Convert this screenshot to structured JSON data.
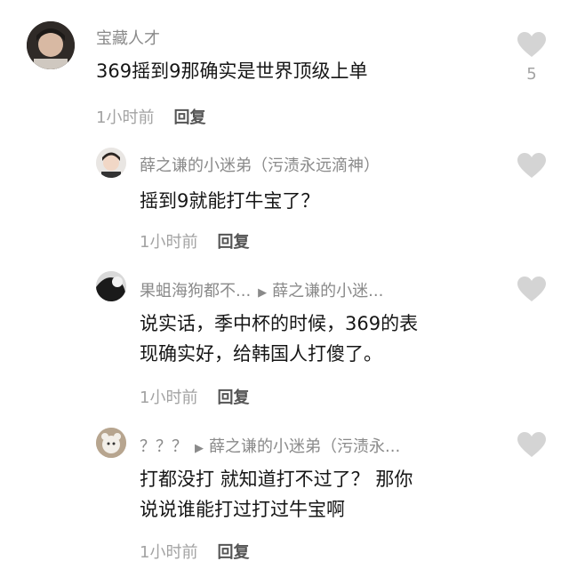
{
  "comments": [
    {
      "user": "宝藏人才",
      "text": "369摇到9那确实是世界顶级上单",
      "time": "1小时前",
      "reply_label": "回复",
      "likes": "5",
      "like_icon": "heart-icon"
    },
    {
      "user": "薛之谦的小迷弟（污渍永远滴神）",
      "text": "摇到9就能打牛宝了？",
      "time": "1小时前",
      "reply_label": "回复",
      "like_icon": "heart-icon"
    },
    {
      "user": "果蛆海狗都不...",
      "reply_to": "薛之谦的小迷...",
      "text_line1": "说实话，季中杯的时候，369的表",
      "text_line2": "现确实好，给韩国人打傻了。",
      "time": "1小时前",
      "reply_label": "回复",
      "like_icon": "heart-icon"
    },
    {
      "user": "？？？",
      "reply_to": "薛之谦的小迷弟（污渍永...",
      "text_line1": "打都没打 就知道打不过了？ 那你",
      "text_line2": "说说谁能打过打过牛宝啊",
      "time": "1小时前",
      "reply_label": "回复",
      "like_icon": "heart-icon"
    }
  ]
}
